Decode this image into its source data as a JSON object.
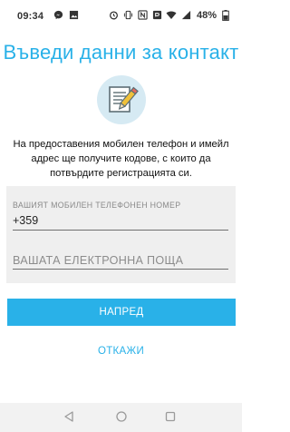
{
  "status_bar": {
    "time": "09:34",
    "battery": "48%",
    "left_icons": [
      "messenger-icon",
      "image-icon"
    ],
    "right_icons": [
      "alarm-icon",
      "vibrate-icon",
      "nfc-icon",
      "data-icon",
      "wifi-icon",
      "signal-icon",
      "battery-icon"
    ]
  },
  "title": "Въведи данни за контакт",
  "info_text": "На предоставения мобилен телефон и имейл адрес ще получите кодове, с които да потвърдите регистрацията си.",
  "form": {
    "phone_label": "ВАШИЯТ МОБИЛЕН ТЕЛЕФОНЕН НОМЕР",
    "phone_value": "+359",
    "email_placeholder": "ВАШАТА ЕЛЕКТРОННА ПОЩА"
  },
  "next_button": "НАПРЕД",
  "cancel_link": "ОТКАЖИ",
  "colors": {
    "accent": "#29b1e8",
    "form_bg": "#efefef",
    "icon_circle": "#d6eaf3"
  }
}
